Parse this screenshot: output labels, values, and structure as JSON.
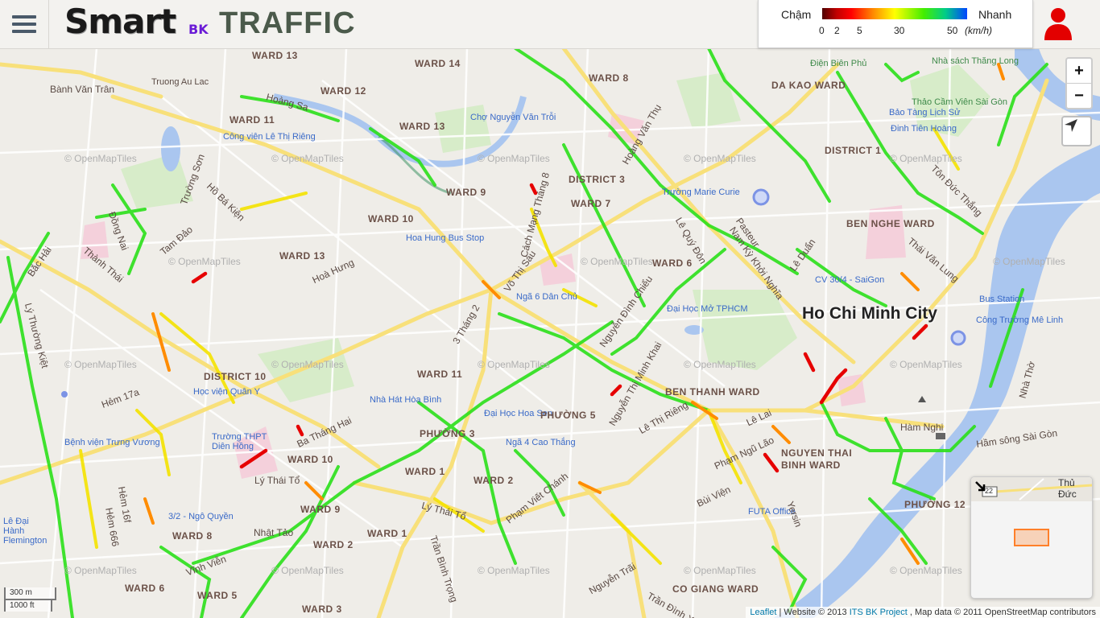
{
  "header": {
    "logo_main": "Smart",
    "logo_sub": "BK",
    "logo_title": "TRAFFIC"
  },
  "legend": {
    "slow_label": "Chậm",
    "fast_label": "Nhanh",
    "ticks": [
      "0",
      "2",
      "5",
      "30",
      "50"
    ],
    "unit": "(km/h)"
  },
  "icons": {
    "menu": "hamburger-icon",
    "user": "user-icon",
    "locate": "locate-arrow-icon",
    "minimap_toggle": "collapse-arrow-icon"
  },
  "zoom": {
    "in": "+",
    "out": "−"
  },
  "map": {
    "labels": [
      "WARD 13",
      "WARD 14",
      "WARD 12",
      "WARD 11",
      "WARD 13",
      "Bành Văn Trân",
      "Truong Au Lac",
      "Công viên Lê Thị Riêng",
      "Chợ Nguyễn Văn Trỗi",
      "WARD 8",
      "Điện Biên Phủ",
      "DA KAO WARD",
      "Nhà sách Thăng Long",
      "Thảo Cầm Viên Sài Gòn",
      "DISTRICT 3",
      "WARD 9",
      "WARD 7",
      "DISTRICT 1",
      "WARD 10",
      "Hoa Hung Bus Stop",
      "Trường Marie Curie",
      "BEN NGHE WARD",
      "WARD 13",
      "Hoà Hưng",
      "WARD 6",
      "Ho Chi Minh City",
      "Bus Station",
      "Ngã 6 Dân Chủ",
      "Đại Học Mở TPHCM",
      "DISTRICT 10",
      "Học viện Quân Y",
      "WARD 11",
      "Nhà Hát Hòa Bình",
      "BEN THANH WARD",
      "Đại Học Hoa Sen",
      "PHƯỜNG 5",
      "PHƯỜNG 3",
      "Ngã 4 Cao Thắng",
      "WARD 10",
      "Lý Thái Tổ",
      "WARD 1",
      "WARD 2",
      "NGUYEN THAI BINH WARD",
      "WARD 9",
      "WARD 8",
      "Vĩnh Viễn",
      "WARD 2",
      "WARD 1",
      "WARD 6",
      "WARD 5",
      "WARD 3",
      "CO GIANG WARD",
      "PHƯỜNG 12",
      "Hàm Nghi",
      "Hầm sông Sài Gòn",
      "FUTA Office",
      "Bệnh viện Trưng Vương",
      "Lê Đại Hành Flemington",
      "Phạm Viết Chánh",
      "Trần Bình Trọng",
      "Nhật Tảo",
      "Lý Thái Tổ",
      "Hoàng Sa",
      "Trường Sơn",
      "Thành Thái",
      "3 Tháng 2",
      "Võ Thị Sáu",
      "Nguyễn Đình Chiểu",
      "Pasteur",
      "Lê Quý Đôn",
      "Lê Lai",
      "Phạm Ngũ Lão",
      "Bùi Viện",
      "Lê Thị Riêng",
      "Tôn Đức Thắng",
      "Thái Văn Lung",
      "Công Trường Mê Linh",
      "Nhà Thờ",
      "Hẻm 17a",
      "Hẻm 16f",
      "Hẻm 666",
      "Trường THPT Diên Hồng",
      "3/2 - Ngô Quyền",
      "Nguyễn Thị Minh Khai",
      "Cách Mạng Tháng 8",
      "Hồ Bá Kiện",
      "Tam Đảo",
      "Đồng Nai",
      "Bắc Hải",
      "Lý Thường Kiệt",
      "Ba Tháng Hai",
      "Thủ Đức",
      "CV 30/4 - SaiGon",
      "Lê Duẩn",
      "Nam Kỳ Khởi Nghĩa",
      "Đinh Tiên Hoàng",
      "Bảo Tàng Lịch Sử",
      "Hoàng Văn Thụ",
      "Yersin",
      "Nguyễn Trãi",
      "Trần Đình Xu"
    ],
    "watermark": "© OpenMapTiles"
  },
  "minimap": {
    "label": "Thủ Đức",
    "shield": "22"
  },
  "scale": {
    "metric": "300 m",
    "imperial": "1000 ft"
  },
  "attribution": {
    "leaflet": "Leaflet",
    "website": "| Website © 2013 ",
    "project": "ITS BK Project",
    "osm": ", Map data © 2011 OpenStreetMap contributors"
  }
}
